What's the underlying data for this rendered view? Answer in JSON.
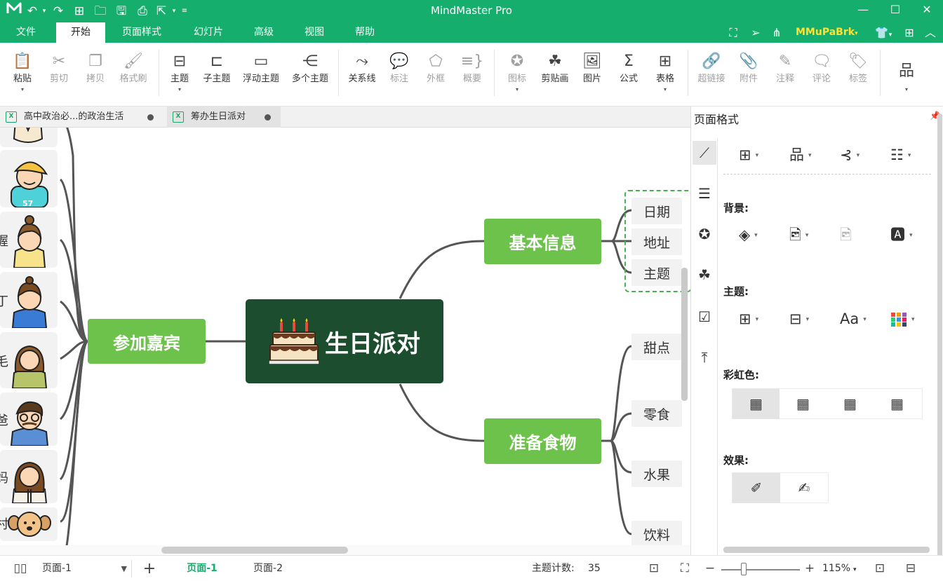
{
  "window": {
    "title": "MindMaster Pro",
    "controls": {
      "minimize": "—",
      "maximize": "☐",
      "close": "✕"
    }
  },
  "menu": {
    "items": [
      "文件",
      "开始",
      "页面样式",
      "幻灯片",
      "高级",
      "视图",
      "帮助"
    ],
    "active_index": 1,
    "user": "MMuPaBrk",
    "user_caret": "▾"
  },
  "ribbon": {
    "buttons": [
      {
        "label": "粘贴",
        "icon": "paste-icon"
      },
      {
        "label": "剪切",
        "icon": "cut-icon"
      },
      {
        "label": "拷贝",
        "icon": "copy-icon"
      },
      {
        "label": "格式刷",
        "icon": "format-painter-icon"
      },
      {
        "label": "主题",
        "icon": "topic-icon"
      },
      {
        "label": "子主题",
        "icon": "subtopic-icon"
      },
      {
        "label": "浮动主题",
        "icon": "floating-topic-icon"
      },
      {
        "label": "多个主题",
        "icon": "multiple-topics-icon"
      },
      {
        "label": "关系线",
        "icon": "relationship-icon"
      },
      {
        "label": "标注",
        "icon": "callout-icon"
      },
      {
        "label": "外框",
        "icon": "boundary-icon"
      },
      {
        "label": "概要",
        "icon": "summary-icon"
      },
      {
        "label": "图标",
        "icon": "mark-icon"
      },
      {
        "label": "剪贴画",
        "icon": "clipart-icon"
      },
      {
        "label": "图片",
        "icon": "picture-icon"
      },
      {
        "label": "公式",
        "icon": "formula-icon"
      },
      {
        "label": "表格",
        "icon": "table-icon"
      },
      {
        "label": "超链接",
        "icon": "hyperlink-icon"
      },
      {
        "label": "附件",
        "icon": "attachment-icon"
      },
      {
        "label": "注释",
        "icon": "note-icon"
      },
      {
        "label": "评论",
        "icon": "comment-icon"
      },
      {
        "label": "标签",
        "icon": "tag-icon"
      }
    ]
  },
  "tabs": [
    {
      "title": "高中政治必...的政治生活",
      "active": false
    },
    {
      "title": "筹办生日派对",
      "active": true
    }
  ],
  "mindmap": {
    "central": "生日派对",
    "left_branch": "参加嘉宾",
    "right_branches": [
      {
        "label": "基本信息",
        "children": [
          "日期",
          "地址",
          "主题"
        ]
      },
      {
        "label": "准备食物",
        "children": [
          "甜点",
          "零食",
          "水果",
          "饮料"
        ]
      }
    ],
    "guest_name_fragments": [
      "",
      "",
      "握",
      "丁",
      "毛",
      "爸",
      "妈",
      "村"
    ]
  },
  "panel": {
    "title": "页面格式",
    "sections": {
      "background": "背景:",
      "theme": "主题:",
      "rainbow": "彩虹色:",
      "effect": "效果:"
    }
  },
  "status": {
    "page_selector": "页面-1",
    "page_tabs": [
      "页面-1",
      "页面-2"
    ],
    "active_page_index": 0,
    "topic_count_label": "主题计数:",
    "topic_count": "35",
    "zoom": "115%",
    "zoom_level_percent": 115
  },
  "colors": {
    "brand": "#15ae6c",
    "main_topic": "#6cc24a",
    "central_topic": "#1b4d2e",
    "user_name": "#ffe033"
  }
}
